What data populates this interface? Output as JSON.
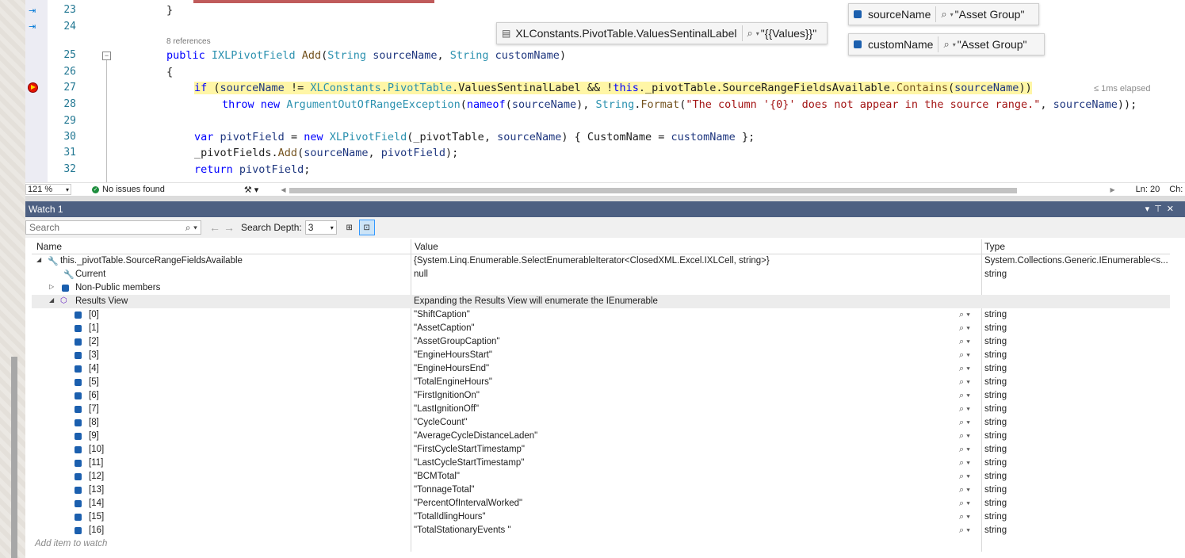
{
  "editor": {
    "references": "8 references",
    "elapsed": "≤ 1ms elapsed",
    "lines": [
      {
        "num": "23",
        "text": "}"
      },
      {
        "num": "24",
        "text": ""
      },
      {
        "num": "25",
        "text": "public IXLPivotField Add(String sourceName, String customName)"
      },
      {
        "num": "26",
        "text": "{"
      },
      {
        "num": "27",
        "text": "if (sourceName != XLConstants.PivotTable.ValuesSentinalLabel && !this._pivotTable.SourceRangeFieldsAvailable.Contains(sourceName))"
      },
      {
        "num": "28",
        "text": "throw new ArgumentOutOfRangeException(nameof(sourceName), String.Format(\"The column '{0}' does not appear in the source range.\", sourceName));"
      },
      {
        "num": "29",
        "text": ""
      },
      {
        "num": "30",
        "text": "var pivotField = new XLPivotField(_pivotTable, sourceName) { CustomName = customName };"
      },
      {
        "num": "31",
        "text": "_pivotFields.Add(sourceName, pivotField);"
      },
      {
        "num": "32",
        "text": "return pivotField;"
      }
    ]
  },
  "datatips": [
    {
      "name": "XLConstants.PivotTable.ValuesSentinalLabel",
      "value": "\"{{Values}}\""
    },
    {
      "name": "sourceName",
      "value": "\"Asset Group\""
    },
    {
      "name": "customName",
      "value": "\"Asset Group\""
    }
  ],
  "status": {
    "zoom": "121 %",
    "issues": "No issues found",
    "position": "Ln: 20",
    "ch": "Ch:"
  },
  "watch": {
    "title": "Watch 1",
    "search_placeholder": "Search",
    "search_depth_label": "Search Depth:",
    "search_depth": "3",
    "columns": [
      "Name",
      "Value",
      "Type"
    ],
    "rows": [
      {
        "name": "this._pivotTable.SourceRangeFieldsAvailable",
        "value": "{System.Linq.Enumerable.SelectEnumerableIterator<ClosedXML.Excel.IXLCell, string>}",
        "type": "System.Collections.Generic.IEnumerable<s..."
      },
      {
        "name": "Current",
        "value": "null",
        "type": "string"
      },
      {
        "name": "Non-Public members",
        "value": "",
        "type": ""
      },
      {
        "name": "Results View",
        "value": "Expanding the Results View will enumerate the IEnumerable",
        "type": ""
      }
    ],
    "items": [
      {
        "index": "[0]",
        "value": "\"ShiftCaption\"",
        "type": "string"
      },
      {
        "index": "[1]",
        "value": "\"AssetCaption\"",
        "type": "string"
      },
      {
        "index": "[2]",
        "value": "\"AssetGroupCaption\"",
        "type": "string"
      },
      {
        "index": "[3]",
        "value": "\"EngineHoursStart\"",
        "type": "string"
      },
      {
        "index": "[4]",
        "value": "\"EngineHoursEnd\"",
        "type": "string"
      },
      {
        "index": "[5]",
        "value": "\"TotalEngineHours\"",
        "type": "string"
      },
      {
        "index": "[6]",
        "value": "\"FirstIgnitionOn\"",
        "type": "string"
      },
      {
        "index": "[7]",
        "value": "\"LastIgnitionOff\"",
        "type": "string"
      },
      {
        "index": "[8]",
        "value": "\"CycleCount\"",
        "type": "string"
      },
      {
        "index": "[9]",
        "value": "\"AverageCycleDistanceLaden\"",
        "type": "string"
      },
      {
        "index": "[10]",
        "value": "\"FirstCycleStartTimestamp\"",
        "type": "string"
      },
      {
        "index": "[11]",
        "value": "\"LastCycleStartTimestamp\"",
        "type": "string"
      },
      {
        "index": "[12]",
        "value": "\"BCMTotal\"",
        "type": "string"
      },
      {
        "index": "[13]",
        "value": "\"TonnageTotal\"",
        "type": "string"
      },
      {
        "index": "[14]",
        "value": "\"PercentOfIntervalWorked\"",
        "type": "string"
      },
      {
        "index": "[15]",
        "value": "\"TotalIdlingHours\"",
        "type": "string"
      },
      {
        "index": "[16]",
        "value": "\"TotalStationaryEvents \"",
        "type": "string"
      }
    ],
    "add_item": "Add item to watch"
  }
}
